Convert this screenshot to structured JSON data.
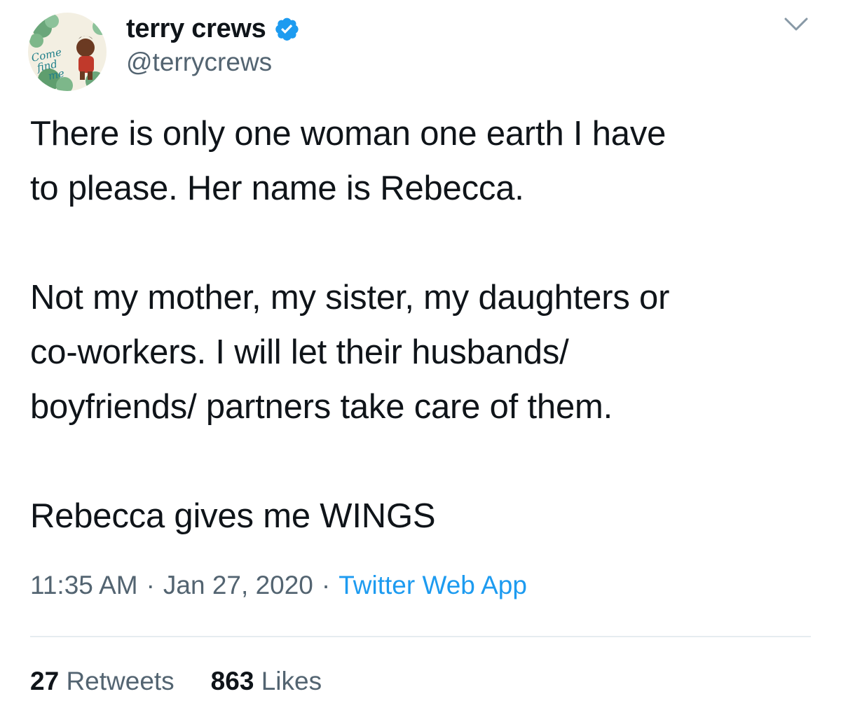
{
  "author": {
    "display_name": "terry crews",
    "handle": "@terrycrews",
    "verified": true,
    "avatar_icon": "book-cover-avatar",
    "avatar_text": "Come find me"
  },
  "tweet": {
    "paragraphs": [
      "There is only one woman one earth I have\nto please. Her name is Rebecca.",
      "Not my mother, my sister, my daughters or\nco-workers. I will let their husbands/\nboyfriends/ partners take care of them.",
      "Rebecca gives me WINGS"
    ]
  },
  "meta": {
    "time": "11:35 AM",
    "separator": "·",
    "date": "Jan 27, 2020",
    "source": "Twitter Web App"
  },
  "stats": {
    "retweets_count": "27",
    "retweets_label": "Retweets",
    "likes_count": "863",
    "likes_label": "Likes"
  },
  "colors": {
    "text": "#0f1419",
    "secondary": "#536471",
    "accent": "#1d9bf0",
    "divider": "#e6ecf0"
  }
}
